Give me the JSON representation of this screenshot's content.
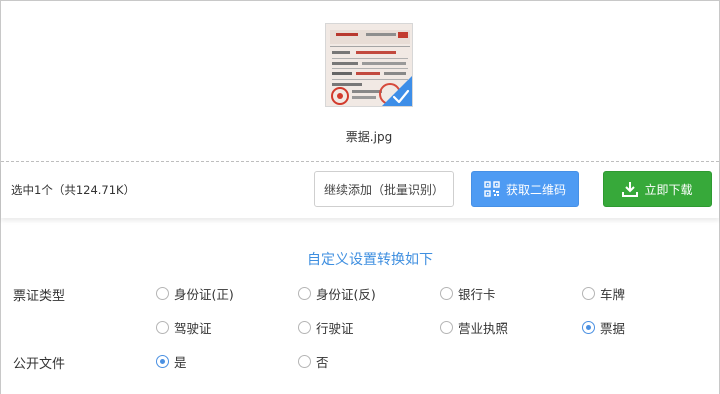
{
  "file": {
    "name": "票据.jpg",
    "selected": true
  },
  "action_bar": {
    "summary": "选中1个（共124.71K）",
    "continue_label": "继续添加（批量识别）",
    "qrcode_label": "获取二维码",
    "download_label": "立即下载"
  },
  "settings": {
    "title": "自定义设置转换如下",
    "doc_type_label": "票证类型",
    "doc_types": [
      {
        "label": "身份证(正)",
        "checked": false
      },
      {
        "label": "身份证(反)",
        "checked": false
      },
      {
        "label": "银行卡",
        "checked": false
      },
      {
        "label": "车牌",
        "checked": false
      },
      {
        "label": "驾驶证",
        "checked": false
      },
      {
        "label": "行驶证",
        "checked": false
      },
      {
        "label": "营业执照",
        "checked": false
      },
      {
        "label": "票据",
        "checked": true
      }
    ],
    "public_label": "公开文件",
    "public_options": [
      {
        "label": "是",
        "checked": true
      },
      {
        "label": "否",
        "checked": false
      }
    ]
  },
  "colors": {
    "accent_blue": "#4e9bf3",
    "download_green": "#37a93a",
    "title_blue": "#3f8fe0"
  },
  "icons": {
    "selected_check": "checkmark-icon",
    "qrcode": "qrcode-icon",
    "download": "download-icon"
  }
}
